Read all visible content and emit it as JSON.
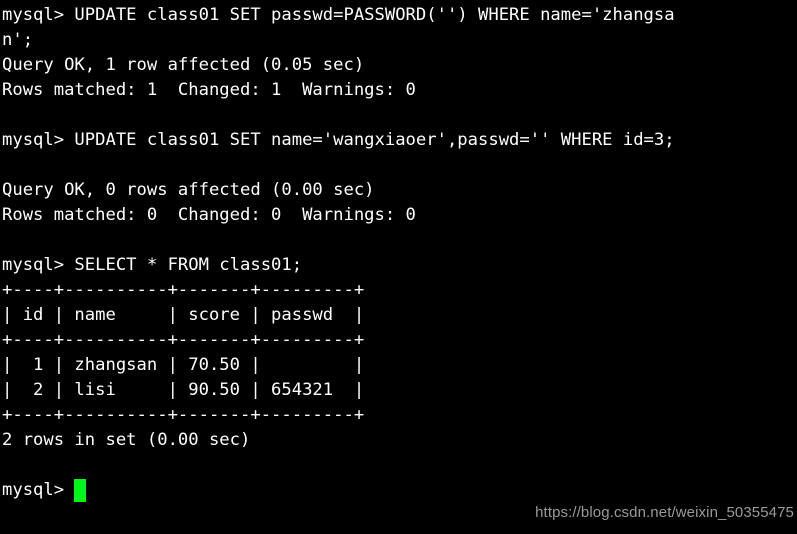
{
  "terminal": {
    "app": "mysql-client",
    "background_color": "#000000",
    "foreground_color": "#ffffff",
    "cursor_color": "#00f51a",
    "prompt": "mysql> ",
    "columns": 66,
    "lines": [
      {
        "id": "l01",
        "kind": "command",
        "text": "mysql> UPDATE class01 SET passwd=PASSWORD('') WHERE name='zhangsa"
      },
      {
        "id": "l02",
        "kind": "command-wrap",
        "text": "n';"
      },
      {
        "id": "l03",
        "kind": "result",
        "text": "Query OK, 1 row affected (0.05 sec)"
      },
      {
        "id": "l04",
        "kind": "result",
        "text": "Rows matched: 1  Changed: 1  Warnings: 0"
      },
      {
        "id": "l05",
        "kind": "blank",
        "text": ""
      },
      {
        "id": "l06",
        "kind": "command",
        "text": "mysql> UPDATE class01 SET name='wangxiaoer',passwd='' WHERE id=3;"
      },
      {
        "id": "l07",
        "kind": "blank",
        "text": ""
      },
      {
        "id": "l08",
        "kind": "result",
        "text": "Query OK, 0 rows affected (0.00 sec)"
      },
      {
        "id": "l09",
        "kind": "result",
        "text": "Rows matched: 0  Changed: 0  Warnings: 0"
      },
      {
        "id": "l10",
        "kind": "blank",
        "text": ""
      },
      {
        "id": "l11",
        "kind": "command",
        "text": "mysql> SELECT * FROM class01;"
      },
      {
        "id": "l12",
        "kind": "table-rule",
        "text": "+----+----------+-------+---------+"
      },
      {
        "id": "l13",
        "kind": "table-header",
        "text": "| id | name     | score | passwd  |"
      },
      {
        "id": "l14",
        "kind": "table-rule",
        "text": "+----+----------+-------+---------+"
      },
      {
        "id": "l15",
        "kind": "table-row",
        "text": "|  1 | zhangsan | 70.50 |         |"
      },
      {
        "id": "l16",
        "kind": "table-row",
        "text": "|  2 | lisi     | 90.50 | 654321  |"
      },
      {
        "id": "l17",
        "kind": "table-rule",
        "text": "+----+----------+-------+---------+"
      },
      {
        "id": "l18",
        "kind": "result",
        "text": "2 rows in set (0.00 sec)"
      },
      {
        "id": "l19",
        "kind": "blank",
        "text": ""
      }
    ],
    "active_prompt": "mysql> ",
    "cursor_glyph": "block"
  },
  "result_table": {
    "type": "table",
    "columns": [
      "id",
      "name",
      "score",
      "passwd"
    ],
    "rows": [
      {
        "id": "1",
        "name": "zhangsan",
        "score": "70.50",
        "passwd": ""
      },
      {
        "id": "2",
        "name": "lisi",
        "score": "90.50",
        "passwd": "654321"
      }
    ],
    "row_count_text": "2 rows in set (0.00 sec)"
  },
  "statements": [
    {
      "sql": "UPDATE class01 SET passwd=PASSWORD('') WHERE name='zhangsan';",
      "status": "Query OK, 1 row affected (0.05 sec)",
      "detail": "Rows matched: 1  Changed: 1  Warnings: 0"
    },
    {
      "sql": "UPDATE class01 SET name='wangxiaoer',passwd='' WHERE id=3;",
      "status": "Query OK, 0 rows affected (0.00 sec)",
      "detail": "Rows matched: 0  Changed: 0  Warnings: 0"
    },
    {
      "sql": "SELECT * FROM class01;",
      "status": "2 rows in set (0.00 sec)",
      "detail": ""
    }
  ],
  "watermark": {
    "text": "https://blog.csdn.net/weixin_50355475",
    "color": "#9a9a9a"
  }
}
